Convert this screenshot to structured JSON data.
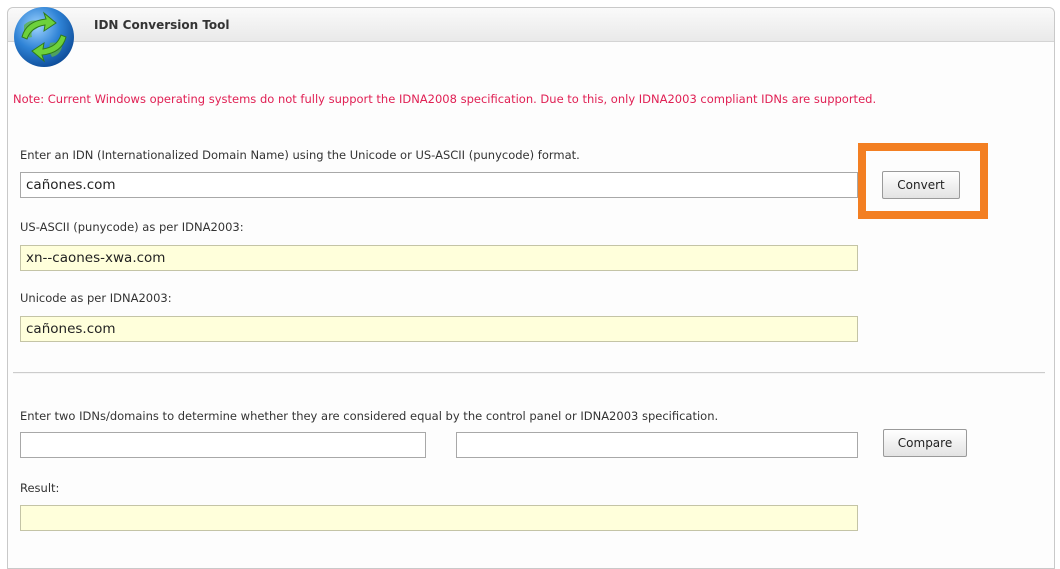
{
  "header": {
    "title": "IDN Conversion Tool",
    "icon": "globe-refresh-icon"
  },
  "note": "Note: Current Windows operating systems do not fully support the IDNA2008 specification. Due to this, only IDNA2003 compliant IDNs are supported.",
  "convert_section": {
    "input_label": "Enter an IDN (Internationalized Domain Name) using the Unicode or US-ASCII (punycode) format.",
    "input_value": "cañones.com",
    "convert_label": "Convert",
    "punycode_label": "US-ASCII (punycode) as per IDNA2003:",
    "punycode_value": "xn--caones-xwa.com",
    "unicode_label": "Unicode as per IDNA2003:",
    "unicode_value": "cañones.com"
  },
  "compare_section": {
    "label": "Enter two IDNs/domains to determine whether they are considered equal by the control panel or IDNA2003 specification.",
    "first_value": "",
    "second_value": "",
    "compare_label": "Compare",
    "result_label": "Result:",
    "result_value": ""
  },
  "colors": {
    "note_text": "#e02054",
    "highlight_border": "#f37f22",
    "readonly_field_bg": "#ffffdb"
  }
}
